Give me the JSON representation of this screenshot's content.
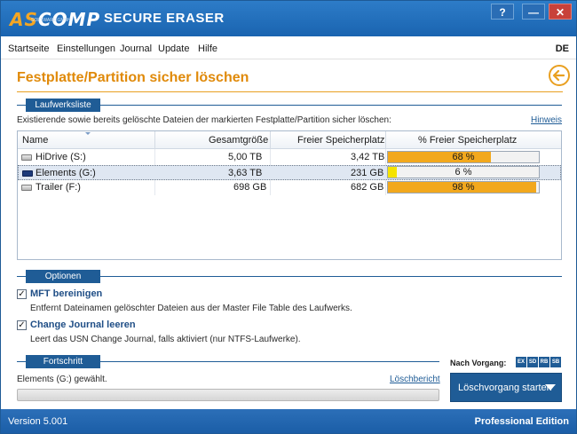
{
  "window": {
    "title": "SECURE ERASER",
    "logo_text": "ASCOMP",
    "logo_subtext": "SOFTWARE GMBH",
    "help_button": "?",
    "minimize_button": "—",
    "close_button": "✕"
  },
  "menu": {
    "items": [
      "Startseite",
      "Einstellungen",
      "Journal",
      "Update",
      "Hilfe"
    ],
    "language": "DE"
  },
  "page": {
    "title": "Festplatte/Partition sicher löschen",
    "back_icon": "←"
  },
  "drives": {
    "section_label": "Laufwerksliste",
    "description": "Existierende sowie bereits gelöschte Dateien der markierten Festplatte/Partition sicher löschen:",
    "hint_link": "Hinweis",
    "columns": [
      "Name",
      "Gesamtgröße",
      "Freier Speicherplatz",
      "% Freier Speicherplatz"
    ],
    "rows": [
      {
        "name": "HiDrive (S:)",
        "total": "5,00 TB",
        "free": "3,42 TB",
        "percent_label": "68 %",
        "percent": 68,
        "bar_color": "#f2a81d",
        "icon": "drive-icon",
        "selected": false
      },
      {
        "name": "Elements (G:)",
        "total": "3,63 TB",
        "free": "231 GB",
        "percent_label": "6 %",
        "percent": 6,
        "bar_color": "#f5e300",
        "icon": "wd-drive-icon",
        "selected": true
      },
      {
        "name": "Trailer (F:)",
        "total": "698 GB",
        "free": "682 GB",
        "percent_label": "98 %",
        "percent": 98,
        "bar_color": "#f2a81d",
        "icon": "drive-icon",
        "selected": false
      }
    ]
  },
  "options": {
    "section_label": "Optionen",
    "items": [
      {
        "title": "MFT bereinigen",
        "description": "Entfernt Dateinamen gelöschter Dateien aus der Master File Table des Laufwerks.",
        "checked": true
      },
      {
        "title": "Change Journal leeren",
        "description": "Leert das USN Change Journal, falls aktiviert (nur NTFS-Laufwerke).",
        "checked": true
      }
    ]
  },
  "progress": {
    "section_label": "Fortschritt",
    "status": "Elements (G:) gewählt.",
    "report_link": "Löschbericht",
    "value": 0
  },
  "action": {
    "after_label": "Nach Vorgang:",
    "after_buttons": [
      "EX",
      "SD",
      "RB",
      "SB"
    ],
    "start_label": "Löschvorgang starten"
  },
  "footer": {
    "version": "Version 5.001",
    "edition": "Professional Edition"
  },
  "colors": {
    "accent_orange": "#e08a0a",
    "brand_blue": "#1f5c96"
  }
}
